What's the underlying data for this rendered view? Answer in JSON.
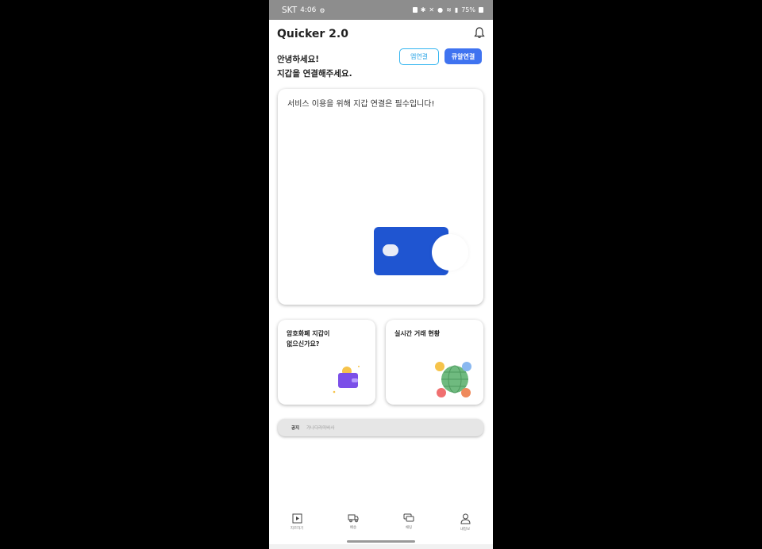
{
  "status_bar": {
    "carrier": "SKT",
    "time": "4:06",
    "battery": "75%"
  },
  "app": {
    "title": "Quicker 2.0"
  },
  "greeting": {
    "line1": "안녕하세요!",
    "line2": "지갑을 연결해주세요."
  },
  "buttons": {
    "outline_label": "앱연결",
    "solid_label": "큐알연결"
  },
  "main_card": {
    "text": "서비스 이용을 위해 지갑 연결은 필수입니다!"
  },
  "small_cards": [
    {
      "line1": "암호화폐 지갑이",
      "line2": "없으신가요?"
    },
    {
      "title": "실시간 거래 현황"
    }
  ],
  "notice": {
    "label": "공지",
    "text": "가나다라마바사"
  },
  "bottom_nav": [
    {
      "label": "지르하기",
      "icon": "add-square-icon"
    },
    {
      "label": "배송",
      "icon": "truck-icon"
    },
    {
      "label": "채팅",
      "icon": "chat-icon"
    },
    {
      "label": "내정보",
      "icon": "user-icon"
    }
  ],
  "colors": {
    "accent": "#3f73f0",
    "outline": "#33b5f0",
    "wallet": "#1f55d1"
  }
}
